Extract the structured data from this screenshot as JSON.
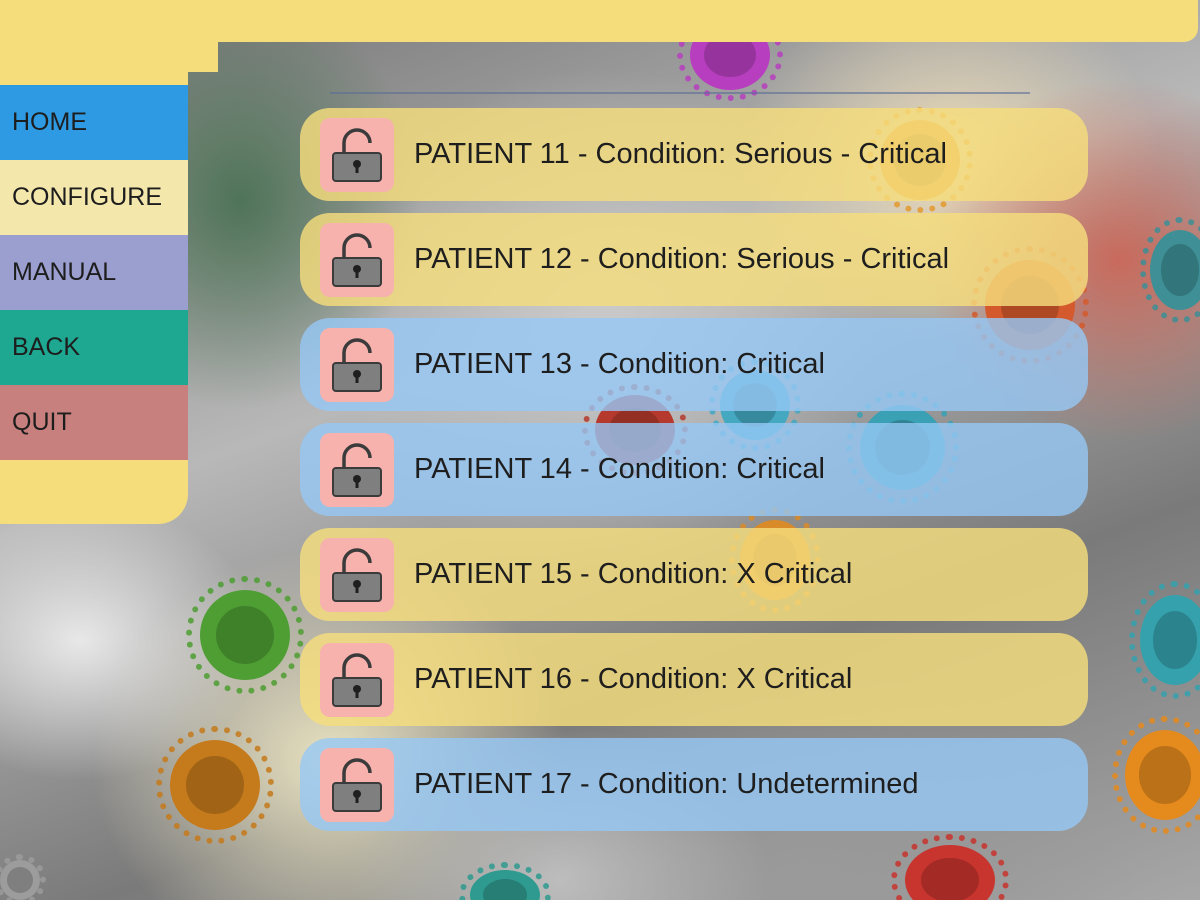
{
  "sidebar": {
    "items": [
      {
        "label": "HOME",
        "color": "#2e9ae3"
      },
      {
        "label": "CONFIGURE",
        "color": "#f3e7ac"
      },
      {
        "label": "MANUAL",
        "color": "#9b9fd0"
      },
      {
        "label": "BACK",
        "color": "#1ea891"
      },
      {
        "label": "QUIT",
        "color": "#c7807d"
      }
    ]
  },
  "theme": {
    "frame_color": "#f5dd7c",
    "row_yellow": "#f5dd7c",
    "row_blue": "#96c8f5",
    "lock_tile": "#f7b2ae",
    "lock_icon": "unlocked-padlock-icon"
  },
  "patients": [
    {
      "label": "PATIENT 11 - Condition: Serious - Critical",
      "style": "yellow"
    },
    {
      "label": "PATIENT 12 - Condition: Serious - Critical",
      "style": "yellow"
    },
    {
      "label": "PATIENT 13 - Condition: Critical",
      "style": "blue"
    },
    {
      "label": "PATIENT 14 - Condition: Critical",
      "style": "blue"
    },
    {
      "label": "PATIENT 15 - Condition: X Critical",
      "style": "yellow"
    },
    {
      "label": "PATIENT 16 - Condition: X Critical",
      "style": "yellow"
    },
    {
      "label": "PATIENT 17 - Condition: Undetermined",
      "style": "blue"
    }
  ]
}
